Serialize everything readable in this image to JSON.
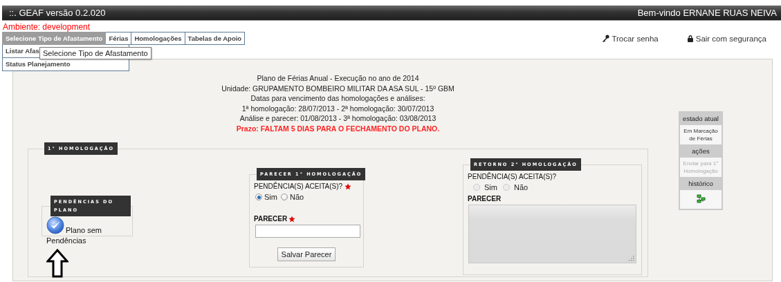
{
  "header": {
    "title": "::. GEAF versão 0.2.020",
    "welcome": "Bem-vindo ERNANE RUAS NEIVA"
  },
  "environment": "Ambiente: development",
  "tabs": [
    {
      "label": "Selecione Tipo de Afastamento",
      "selected": true
    },
    {
      "label": "Férias",
      "selected": false
    },
    {
      "label": "Homologações",
      "selected": false
    },
    {
      "label": "Tabelas de Apoio",
      "selected": false
    }
  ],
  "menu": {
    "items": [
      "Listar Afas",
      "Status Planejamento"
    ]
  },
  "tooltip": "Selecione Tipo de Afastamento",
  "user_links": [
    {
      "kind": "password",
      "label": "Trocar senha"
    },
    {
      "kind": "logout",
      "label": "Sair com segurança"
    }
  ],
  "plan_info": [
    {
      "kind": "normal",
      "text": "Plano de Férias Anual - Execução no ano de 2014"
    },
    {
      "kind": "normal",
      "text": "Unidade: GRUPAMENTO BOMBEIRO MILITAR DA ASA SUL - 15º GBM"
    },
    {
      "kind": "normal",
      "text": "Datas para vencimento das homologações e análises:"
    },
    {
      "kind": "normal",
      "text": "1ª homologação: 28/07/2013 - 2ª homologação: 30/07/2013"
    },
    {
      "kind": "normal",
      "text": "Análise e parecer: 01/08/2013 - 3ª homologação: 03/08/2013"
    },
    {
      "kind": "warning",
      "text": "Prazo: FALTAM 5 DIAS PARA O FECHAMENTO DO PLANO."
    }
  ],
  "homologacao_1": {
    "legend": "1° HOMOLOGAÇÃO",
    "pendencias": {
      "legend": "PENDÊNCIAS DO PLANO",
      "status": "Plano sem Pendências"
    },
    "parecer": {
      "legend": "PARECER 1° HOMOLOGAÇÃO",
      "question": "PENDÊNCIA(S) ACEITA(S)?",
      "required": true,
      "disabled": false,
      "options": [
        {
          "label": "Sim",
          "selected": true
        },
        {
          "label": "Não",
          "selected": false
        }
      ],
      "parecer_label": "PARECER",
      "button": "Salvar Parecer"
    },
    "retorno": {
      "legend": "RETORNO 2° HOMOLOGAÇÃO",
      "question": "PENDÊNCIA(S) ACEITA(S)?",
      "required": false,
      "disabled": true,
      "options": [
        {
          "label": "Sim",
          "selected": false
        },
        {
          "label": "Não",
          "selected": false
        }
      ],
      "parecer_label": "PARECER"
    }
  },
  "status_panel": {
    "estado_label": "estado atual",
    "estado": "Em Marcação de Férias",
    "acoes_label": "ações",
    "acao": {
      "label": "Enviar para 1° Homologação",
      "disabled": true
    },
    "historico_label": "histórico"
  }
}
